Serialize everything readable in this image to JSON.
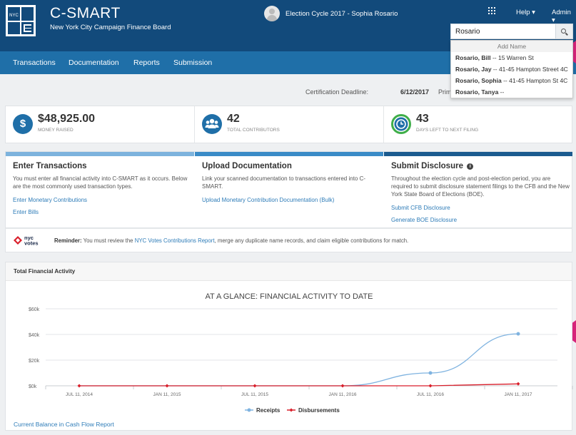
{
  "header": {
    "app_title": "C-SMART",
    "subtitle": "New York City Campaign Finance Board",
    "logo_text": "NYC",
    "cycle": "Election Cycle 2017 - Sophia Rosario",
    "help": "Help ▾",
    "admin": "Admin ▾"
  },
  "search": {
    "value": "Rosario",
    "placeholder": ""
  },
  "nav": {
    "items": [
      "Transactions",
      "Documentation",
      "Reports",
      "Submission"
    ]
  },
  "dropdown": {
    "header": "Add Name",
    "items": [
      {
        "name": "Rosario, Bill",
        "detail": " -- 15 Warren St"
      },
      {
        "name": "Rosario, Jay",
        "detail": " -- 41-45 Hampton Street 4C"
      },
      {
        "name": "Rosario, Sophia",
        "detail": " -- 41-45 Hampton St 4C"
      },
      {
        "name": "Rosario, Tanya",
        "detail": " --"
      }
    ]
  },
  "deadline": {
    "label": "Certification Deadline:",
    "value": "6/12/2017",
    "primary": "Primary Dat"
  },
  "stats": [
    {
      "icon": "dollar-icon",
      "value": "$48,925.00",
      "label": "MONEY RAISED"
    },
    {
      "icon": "contributors-icon",
      "value": "42",
      "label": "TOTAL CONTRIBUTORS"
    },
    {
      "icon": "clock-icon",
      "value": "43",
      "label": "DAYS LEFT TO NEXT FILING"
    }
  ],
  "cards": [
    {
      "title": "Enter Transactions",
      "text": "You must enter all financial activity into C-SMART as it occurs. Below are the most commonly used transaction types.",
      "links": [
        "Enter Monetary Contributions",
        "Enter Bills"
      ],
      "bar_color": "#7db3dd"
    },
    {
      "title": "Upload Documentation",
      "text": "Link your scanned documentation to transactions entered into C-SMART.",
      "links": [
        "Upload Monetary Contribution Documentation (Bulk)"
      ],
      "bar_color": "#3a8bc7"
    },
    {
      "title": "Submit Disclosure",
      "text": "Throughout the election cycle and post-election period, you are required to submit disclosure statement filings to the CFB and the New York State Board of Elections (BOE).",
      "links": [
        "Submit CFB Disclosure",
        "Generate BOE Disclosure"
      ],
      "bar_color": "#1b5b8f"
    }
  ],
  "reminder": {
    "logo_text": "nyc votes",
    "lead": "Reminder:",
    "before": " You must review the ",
    "link": "NYC Votes Contributions Report",
    "after": ", merge any duplicate name records, and claim eligible contributions for match."
  },
  "chart_panel": {
    "heading": "Total Financial Activity",
    "footer_link": "Current Balance in Cash Flow Report"
  },
  "colors": {
    "header_bg": "#124a7b",
    "nav_bg": "#1f6fa8",
    "accent": "#1f6fa8",
    "receipts": "#7fb3e0",
    "disbursements": "#d91f2b",
    "pointer": "#d6247a"
  },
  "chart_data": {
    "type": "line",
    "title": "AT A GLANCE: FINANCIAL ACTIVITY TO DATE",
    "categories": [
      "JUL 11, 2014",
      "JAN 11, 2015",
      "JUL 11, 2015",
      "JAN 11, 2016",
      "JUL 11, 2016",
      "JAN 11, 2017"
    ],
    "series": [
      {
        "name": "Receipts",
        "values": [
          0,
          0,
          0,
          0,
          10000,
          40500
        ]
      },
      {
        "name": "Disbursements",
        "values": [
          0,
          0,
          0,
          0,
          0,
          1500
        ]
      }
    ],
    "yticks": [
      "$0k",
      "$20k",
      "$40k",
      "$60k"
    ],
    "ylim": [
      0,
      60000
    ],
    "grid": true,
    "legend": "bottom"
  }
}
